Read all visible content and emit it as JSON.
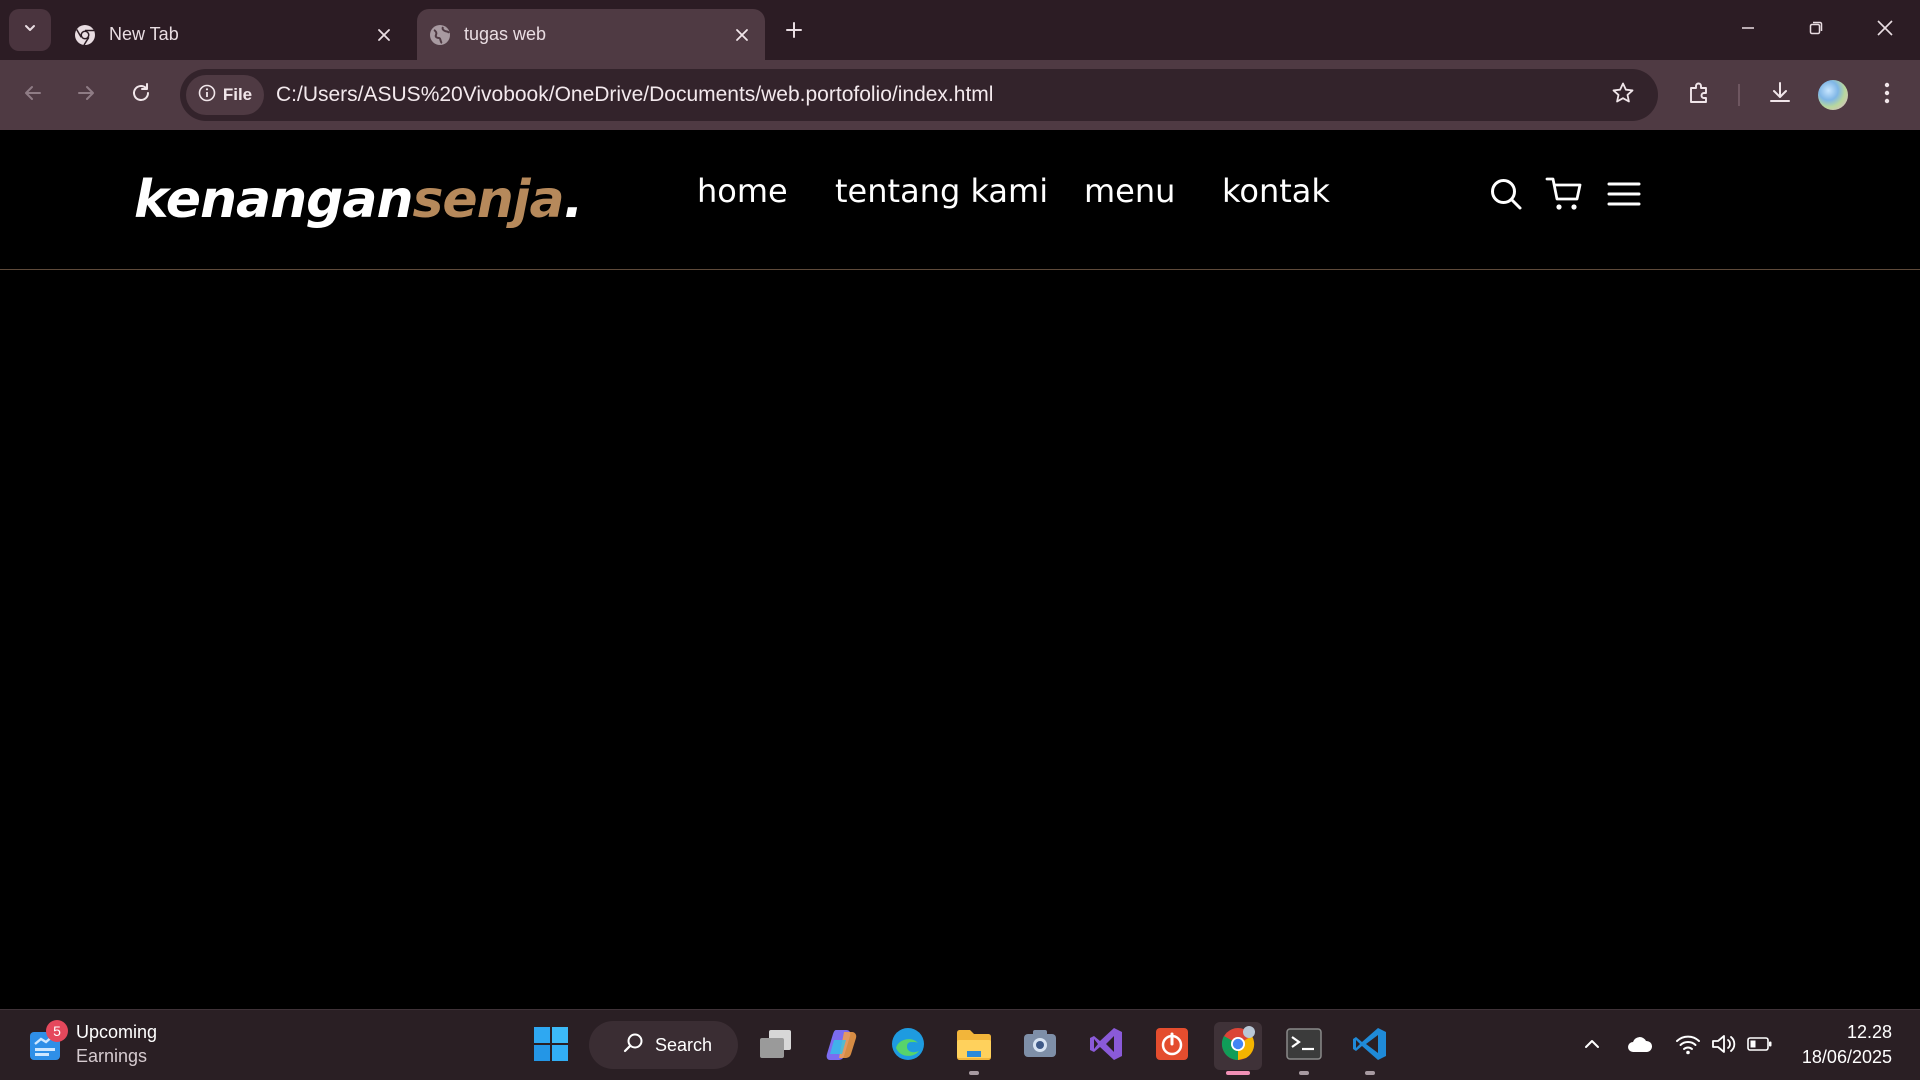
{
  "browser": {
    "tabs": [
      {
        "label": "New Tab",
        "icon": "chrome-icon",
        "active": false
      },
      {
        "label": "tugas web",
        "icon": "globe-icon",
        "active": true
      }
    ],
    "site_chip_label": "File",
    "url": "C:/Users/ASUS%20Vivobook/OneDrive/Documents/web.portofolio/index.html"
  },
  "site": {
    "logo_main": "kenangan",
    "logo_accent": "senja",
    "logo_dot": ".",
    "nav": {
      "home": "home",
      "about": "tentang kami",
      "menu": "menu",
      "contact": "kontak"
    },
    "accent_color": "#b6895b"
  },
  "taskbar": {
    "widget_badge": "5",
    "widget_title": "Upcoming",
    "widget_subtitle": "Earnings",
    "search_label": "Search",
    "time": "12.28",
    "date": "18/06/2025"
  }
}
